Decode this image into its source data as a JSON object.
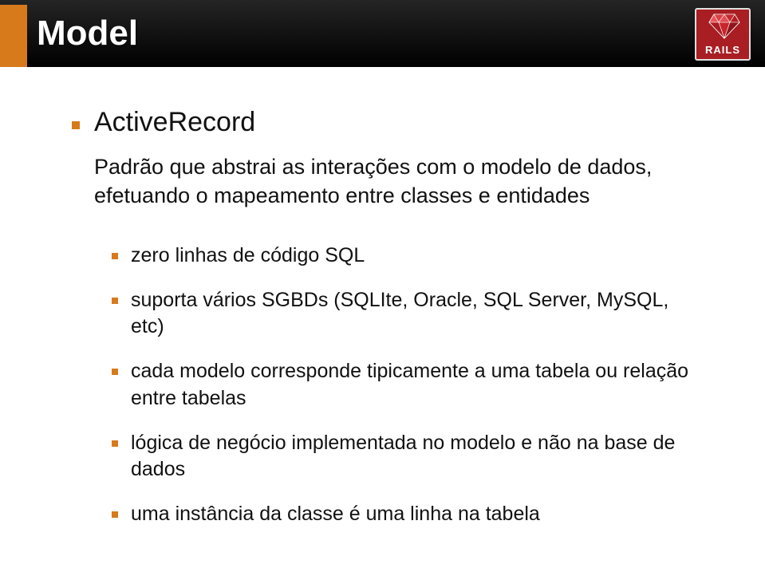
{
  "header": {
    "title": "Model",
    "logo_text": "RAILS"
  },
  "main": {
    "heading": "ActiveRecord",
    "description": "Padrão que abstrai as interações com o modelo de dados, efetuando o mapeamento entre classes e entidades",
    "bullets": [
      "zero linhas de código SQL",
      "suporta vários SGBDs (SQLIte, Oracle, SQL Server, MySQL, etc)",
      "cada modelo corresponde tipicamente a uma tabela ou relação entre tabelas",
      "lógica de negócio implementada no modelo e não na base de dados",
      "uma instância da classe é uma linha na tabela"
    ]
  }
}
